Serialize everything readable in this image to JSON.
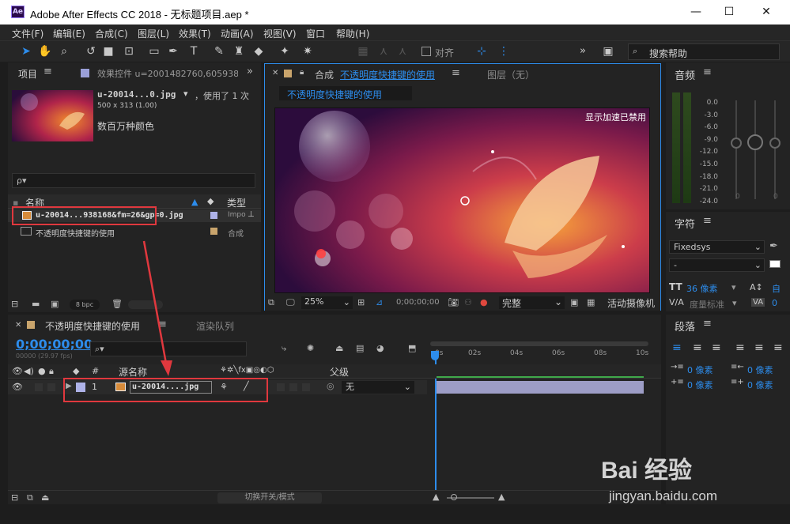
{
  "titlebar": {
    "app_icon": "Ae",
    "title": "Adobe After Effects CC 2018 - 无标题项目.aep *"
  },
  "menu": [
    "文件(F)",
    "编辑(E)",
    "合成(C)",
    "图层(L)",
    "效果(T)",
    "动画(A)",
    "视图(V)",
    "窗口",
    "帮助(H)"
  ],
  "toolbar": {
    "align_label": "对齐",
    "search_placeholder": "搜索帮助",
    "more": "»"
  },
  "project": {
    "tab_label": "项目",
    "effects_tab": "效果控件 u=2001482760,605938",
    "thumb_name": "u-20014...0.jpg",
    "used_count": "，使用了 1 次",
    "dimensions": "500 x 313 (1.00)",
    "color_desc": "数百万种颜色",
    "search_placeholder": "ρ▾",
    "col_name": "名称",
    "col_type": "类型",
    "items": [
      {
        "name": "u-20014...938168&fm=26&gp=0.jpg",
        "type": "Impo"
      },
      {
        "name": "不透明度快捷键的使用",
        "type": "合成"
      }
    ],
    "bpc": "8 bpc"
  },
  "composition": {
    "tab_prefix": "合成",
    "tab_name": "不透明度快捷键的使用",
    "layer_tab": "图层（无）",
    "breadcrumb": "不透明度快捷键的使用",
    "accel_notice": "显示加速已禁用",
    "zoom": "25%",
    "timecode": "0;00;00;00",
    "quality": "完整",
    "camera": "活动摄像机"
  },
  "timeline": {
    "tab_name": "不透明度快捷键的使用",
    "render_queue": "渲染队列",
    "timecode": "0;00;00;00",
    "fps": "00000 (29.97 fps)",
    "col_num": "#",
    "col_source": "源名称",
    "col_parent": "父级",
    "layer_num": "1",
    "layer_name": "u-20014....jpg",
    "parent_value": "无",
    "ticks": [
      "0s",
      "02s",
      "04s",
      "06s",
      "08s",
      "10s"
    ],
    "toggle_label": "切换开关/模式"
  },
  "audio": {
    "tab_label": "音频",
    "db_labels": [
      "0.0",
      "-3.0",
      "-6.0",
      "-9.0",
      "-12.0",
      "-15.0",
      "-18.0",
      "-21.0",
      "-24.0"
    ],
    "zero_left": "0",
    "zero_right": "0"
  },
  "character": {
    "tab_label": "字符",
    "font": "Fixedsys",
    "style": "-",
    "size": "36 像素",
    "leading": "自",
    "tracking_label": "度量标准",
    "va": "0"
  },
  "paragraph": {
    "tab_label": "段落",
    "indent_values": [
      "0 像素",
      "0 像素",
      "0 像素",
      "0 像素"
    ]
  },
  "watermark": {
    "brand": "Bai 经验",
    "url": "jingyan.baidu.com"
  },
  "colors": {
    "accent": "#2d8ceb",
    "highlight": "#e0383e"
  }
}
